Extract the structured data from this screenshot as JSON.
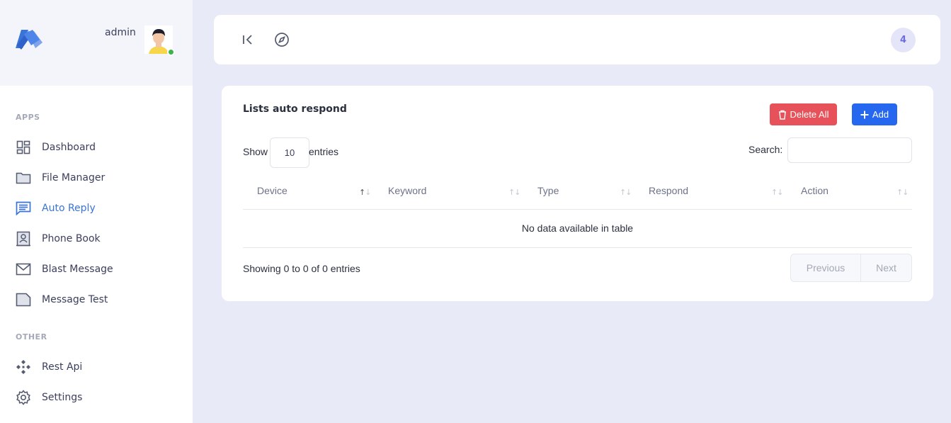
{
  "sidebar": {
    "user_name": "admin",
    "sections": [
      {
        "label": "APPS"
      },
      {
        "label": "OTHER"
      }
    ],
    "items": [
      {
        "label": "Dashboard",
        "icon": "dashboard-icon"
      },
      {
        "label": "File Manager",
        "icon": "folder-icon"
      },
      {
        "label": "Auto Reply",
        "icon": "message-icon",
        "active": true
      },
      {
        "label": "Phone Book",
        "icon": "contact-book-icon"
      },
      {
        "label": "Blast Message",
        "icon": "mail-icon"
      },
      {
        "label": "Message Test",
        "icon": "note-icon"
      },
      {
        "label": "Rest Api",
        "icon": "api-icon"
      },
      {
        "label": "Settings",
        "icon": "gear-icon"
      }
    ]
  },
  "topbar": {
    "badge_count": "4"
  },
  "card": {
    "title": "Lists auto respond",
    "delete_all_label": "Delete All",
    "add_label": "Add",
    "show_label": "Show",
    "entries_value": "10",
    "entries_label": "entries",
    "search_label": "Search:",
    "search_value": "",
    "columns": [
      "Device",
      "Keyword",
      "Type",
      "Respond",
      "Action"
    ],
    "empty_message": "No data available in table",
    "info": "Showing 0 to 0 of 0 entries",
    "pagination": {
      "previous": "Previous",
      "next": "Next"
    }
  },
  "colors": {
    "accent": "#3a74d6",
    "danger": "#e7515a",
    "primary": "#2568ef",
    "online": "#3bb54a",
    "badge_bg": "#e5e5fa"
  }
}
